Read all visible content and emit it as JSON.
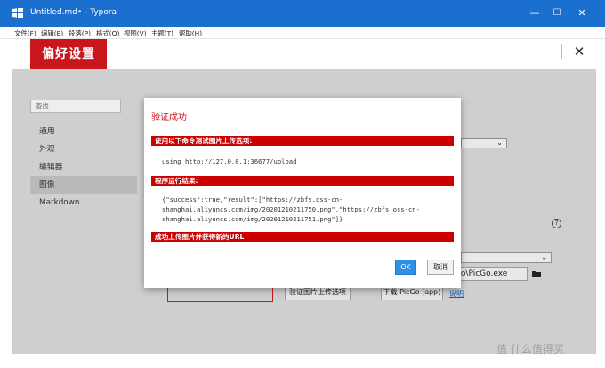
{
  "window": {
    "title": "Untitled.md• - Typora",
    "controls": {
      "minimize": "—",
      "maximize": "☐",
      "close": "✕"
    }
  },
  "menu": [
    "文件(F)",
    "编辑(E)",
    "段落(P)",
    "格式(O)",
    "视图(V)",
    "主题(T)",
    "帮助(H)"
  ],
  "preferences": {
    "title": "偏好设置",
    "close": "✕",
    "search_placeholder": "查找...",
    "nav": [
      "通用",
      "外观",
      "编辑器",
      "图像",
      "Markdown"
    ],
    "active_nav": "图像",
    "path_value": "cGo\\PicGo.exe",
    "validate_button": "验证图片上传选项",
    "download_button": "下载 PicGo (app)",
    "help_link": "说明",
    "help_icon": "?"
  },
  "dialog": {
    "title": "验证成功",
    "section1": "使用以下命令测试图片上传选项:",
    "command": "using http://127.0.0.1:36677/upload",
    "section2": "程序运行结果:",
    "result_line1": "{\"success\":true,\"result\":[\"https://zbfs.oss-cn-",
    "result_line2": "shanghai.aliyuncs.com/img/20201210211750.png\",\"https://zbfs.oss-cn-",
    "result_line3": "shanghai.aliyuncs.com/img/20201210211751.png\"]}",
    "section3": "成功上传图片并获得新的URL",
    "ok": "OK",
    "cancel": "取消"
  },
  "watermark": "值 什么值得买"
}
